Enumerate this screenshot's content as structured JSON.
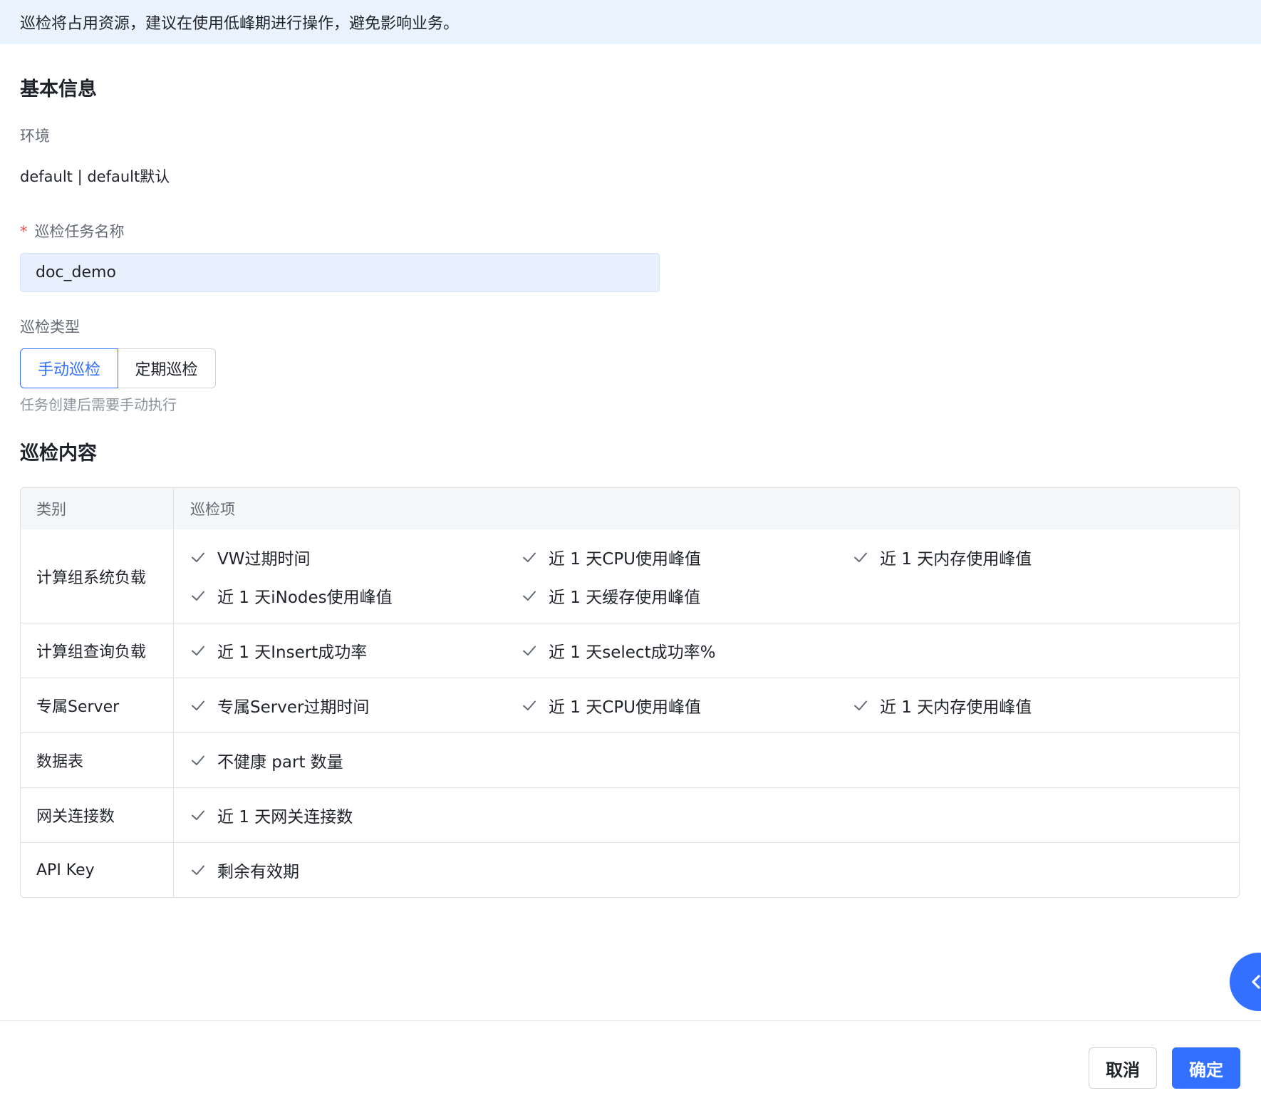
{
  "notice": {
    "text": "巡检将占用资源，建议在使用低峰期进行操作，避免影响业务。"
  },
  "basic_info": {
    "title": "基本信息",
    "env_label": "环境",
    "env_value": "default | default默认",
    "task_name_label": "巡检任务名称",
    "task_name_value": "doc_demo",
    "type_label": "巡检类型",
    "type_options": [
      "手动巡检",
      "定期巡检"
    ],
    "type_selected": "手动巡检",
    "type_hint": "任务创建后需要手动执行"
  },
  "content": {
    "title": "巡检内容",
    "columns": [
      "类别",
      "巡检项"
    ],
    "rows": [
      {
        "category": "计算组系统负载",
        "items": [
          "VW过期时间",
          "近 1 天CPU使用峰值",
          "近 1 天内存使用峰值",
          "近 1 天iNodes使用峰值",
          "近 1 天缓存使用峰值"
        ]
      },
      {
        "category": "计算组查询负载",
        "items": [
          "近 1 天Insert成功率",
          "近 1 天select成功率%"
        ]
      },
      {
        "category": "专属Server",
        "items": [
          "专属Server过期时间",
          "近 1 天CPU使用峰值",
          "近 1 天内存使用峰值"
        ]
      },
      {
        "category": "数据表",
        "items": [
          "不健康 part 数量"
        ]
      },
      {
        "category": "网关连接数",
        "items": [
          "近 1 天网关连接数"
        ]
      },
      {
        "category": "API Key",
        "items": [
          "剩余有效期"
        ]
      }
    ]
  },
  "footer": {
    "cancel_label": "取消",
    "confirm_label": "确定"
  },
  "colors": {
    "accent": "#3370ff",
    "notice_bg": "#e8f3fe",
    "input_bg": "#e8f0fd",
    "required": "#f54a45"
  },
  "icons": {
    "check": "check-icon",
    "float": "chevron-left-icon"
  }
}
